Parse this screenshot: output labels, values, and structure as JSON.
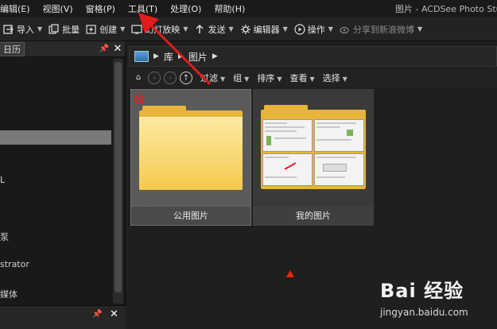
{
  "menu": {
    "items": [
      "编辑(E)",
      "视图(V)",
      "窗格(P)",
      "工具(T)",
      "处理(O)",
      "帮助(H)"
    ],
    "window_title": "图片 - ACDSee Photo Stu"
  },
  "toolbar": {
    "import": "导入",
    "batch": "批量",
    "create": "创建",
    "slideshow": "幻灯放映",
    "send": "发送",
    "editor": "编辑器",
    "action": "操作",
    "share": "分享到新浪微博"
  },
  "left_panel": {
    "tab": "日历",
    "items": [
      "L",
      "泵",
      "strator",
      "媒体"
    ]
  },
  "path": {
    "segments": [
      "库",
      "图片"
    ]
  },
  "filter_bar": {
    "filter": "过滤",
    "group": "组",
    "sort": "排序",
    "view": "查看",
    "select": "选择"
  },
  "files": [
    {
      "name": "公用图片"
    },
    {
      "name": "我的图片"
    }
  ],
  "watermark": {
    "brand": "Bai 经验",
    "url": "jingyan.baidu.com"
  },
  "colors": {
    "accent_red": "#e21b1b",
    "folder_yellow": "#f5c94e",
    "selected_tile": "#5a5a5a"
  }
}
